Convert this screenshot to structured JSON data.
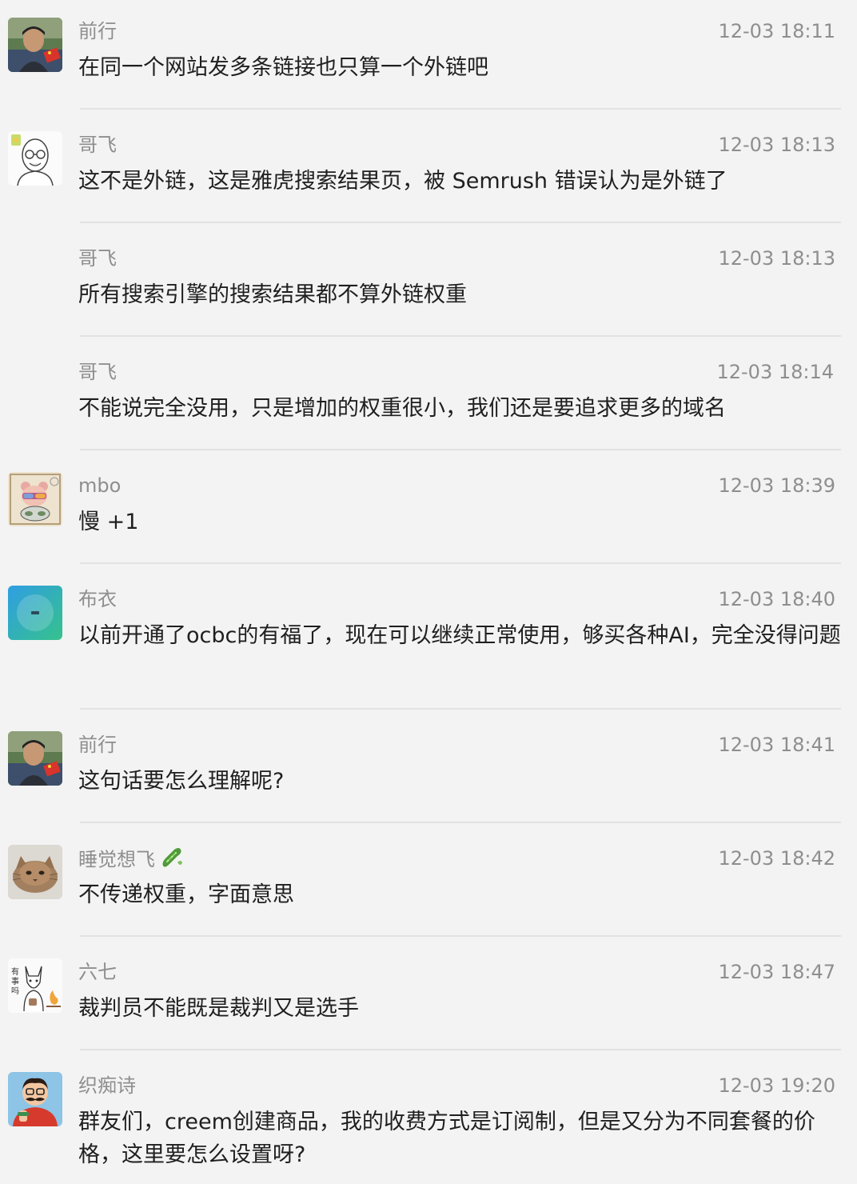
{
  "messages": [
    {
      "sender": "前行",
      "time": "12-03 18:11",
      "text": "在同一个网站发多条链接也只算一个外链吧",
      "avatar": "man-portrait-flag-avatar"
    },
    {
      "sender": "哥飞",
      "time": "12-03 18:13",
      "text": "这不是外链，这是雅虎搜索结果页，被 Semrush 错误认为是外链了",
      "avatar": "bald-glasses-cartoon-avatar"
    },
    {
      "sender": "哥飞",
      "time": "12-03 18:13",
      "text": "所有搜索引擎的搜索结果都不算外链权重",
      "avatar": ""
    },
    {
      "sender": "哥飞",
      "time": "12-03 18:14",
      "text": "不能说完全没用，只是增加的权重很小，我们还是要追求更多的域名",
      "avatar": ""
    },
    {
      "sender": "mbo",
      "time": "12-03 18:39",
      "text": "慢 +1",
      "avatar": "cartoon-bear-sketch-avatar"
    },
    {
      "sender": "布衣",
      "time": "12-03 18:40",
      "text": "以前开通了ocbc的有福了，现在可以继续正常使用，够买各种AI，完全没得问题",
      "avatar": "blue-green-gradient-avatar"
    },
    {
      "sender": "前行",
      "time": "12-03 18:41",
      "text": "这句话要怎么理解呢?",
      "avatar": "man-portrait-flag-avatar"
    },
    {
      "sender": "睡觉想飞",
      "time": "12-03 18:42",
      "text": "不传递权重，字面意思",
      "avatar": "cat-photo-avatar",
      "badge": "cucumber-icon"
    },
    {
      "sender": "六七",
      "time": "12-03 18:47",
      "text": "裁判员不能既是裁判又是选手",
      "avatar": "cartoon-cat-campfire-avatar"
    },
    {
      "sender": "织痴诗",
      "time": "12-03 19:20",
      "text": "群友们，creem创建商品，我的收费方式是订阅制，但是又分为不同套餐的价格，这里要怎么设置呀?",
      "avatar": "cartoon-mustache-man-avatar"
    }
  ],
  "colors": {
    "background": "#f3f3f3",
    "meta_text": "#8e8e8e",
    "message_text": "#1f1f1f",
    "separator": "#e2e2e2"
  }
}
